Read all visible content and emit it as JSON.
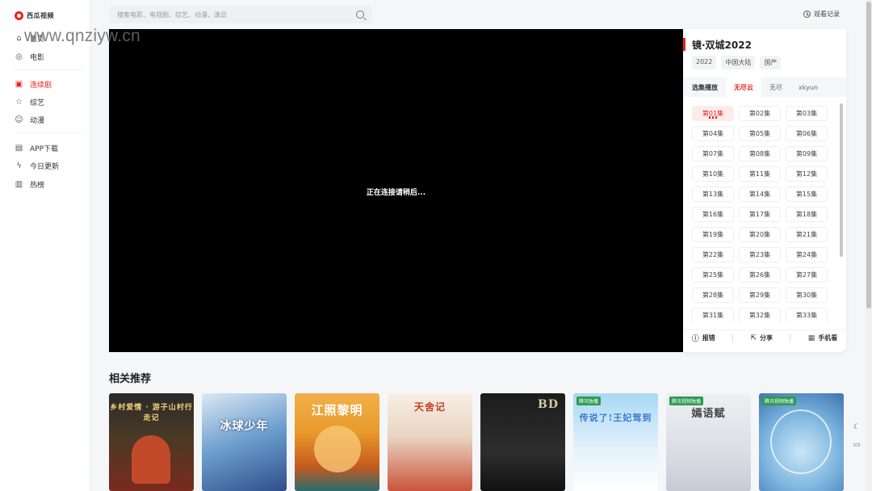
{
  "brand": {
    "name": "西瓜视频"
  },
  "watermark": "www.qnziyw.cn",
  "sidebar": {
    "items": [
      {
        "label": "首页",
        "icon": "home-icon"
      },
      {
        "label": "电影",
        "icon": "film-icon"
      },
      {
        "label": "连续剧",
        "icon": "tv-icon",
        "active": true
      },
      {
        "label": "综艺",
        "icon": "star-icon"
      },
      {
        "label": "动漫",
        "icon": "anime-icon"
      },
      {
        "label": "APP下载",
        "icon": "app-icon"
      },
      {
        "label": "今日更新",
        "icon": "update-icon"
      },
      {
        "label": "热榜",
        "icon": "chart-icon"
      }
    ]
  },
  "search": {
    "placeholder": "搜索电影、电视剧、综艺、动漫、演员"
  },
  "header": {
    "history_label": "观看记录"
  },
  "player": {
    "status": "正在连接请稍后..."
  },
  "panel": {
    "title": "镜·双城2022",
    "tags": [
      "2022",
      "中国大陆",
      "国产"
    ],
    "tabs": [
      {
        "label": "选集播放"
      },
      {
        "label": "无尽云",
        "active": true
      },
      {
        "label": "无尽"
      },
      {
        "label": "xkyun"
      }
    ],
    "episodes": [
      "第01集",
      "第02集",
      "第03集",
      "第04集",
      "第05集",
      "第06集",
      "第07集",
      "第08集",
      "第09集",
      "第10集",
      "第11集",
      "第12集",
      "第13集",
      "第14集",
      "第15集",
      "第16集",
      "第17集",
      "第18集",
      "第19集",
      "第20集",
      "第21集",
      "第22集",
      "第23集",
      "第24集",
      "第25集",
      "第26集",
      "第27集",
      "第28集",
      "第29集",
      "第30集",
      "第31集",
      "第32集",
      "第33集"
    ],
    "active_episode": 0,
    "actions": [
      {
        "label": "报错",
        "icon": "report-icon"
      },
      {
        "label": "分享",
        "icon": "share-icon"
      },
      {
        "label": "手机看",
        "icon": "qrcode-icon"
      }
    ]
  },
  "recommend": {
    "title": "相关推荐",
    "posters": [
      {
        "text": "乡村爱情 · 游子山村行走记"
      },
      {
        "text": "冰球少年"
      },
      {
        "text": "江照黎明"
      },
      {
        "text": "天舍记"
      },
      {
        "text": "BD"
      },
      {
        "text": "传说了!王妃驾到",
        "badge": "腾讯独播"
      },
      {
        "text": "嫣语赋",
        "badge": "腾讯视频独播"
      },
      {
        "text": "",
        "badge": "腾讯视频独播"
      }
    ]
  }
}
